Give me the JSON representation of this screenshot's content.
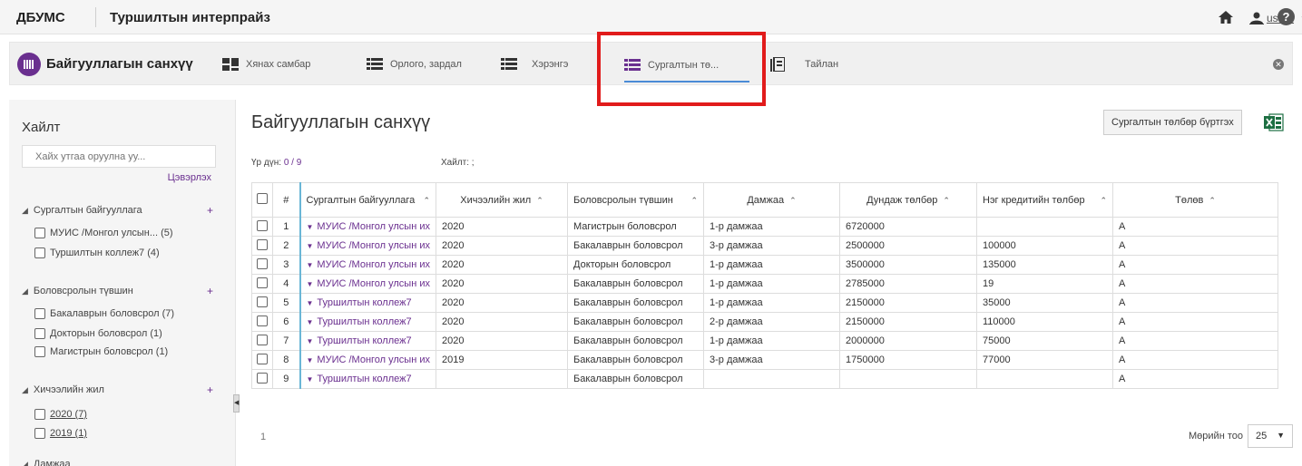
{
  "topbar": {
    "brand": "ДБУМС",
    "subtitle": "Туршилтын интерпрайз",
    "user": "user1"
  },
  "nav": {
    "title": "Байгууллагын санхүү",
    "items": [
      {
        "label": "Хянах самбар",
        "icon": "dashboard-icon"
      },
      {
        "label": "Орлого, зардал",
        "icon": "list-icon"
      },
      {
        "label": "Хэрэнгэ",
        "icon": "list-icon"
      },
      {
        "label": "Сургалтын тө...",
        "icon": "list-icon",
        "active": true
      },
      {
        "label": "Тайлан",
        "icon": "report-icon"
      }
    ],
    "highlight_color": "#e11b1b"
  },
  "sidebar": {
    "heading": "Хайлт",
    "search_placeholder": "Хайх утгаа оруулна уу...",
    "clear_label": "Цэвэрлэх",
    "facets": [
      {
        "title": "Сургалтын байгууллага",
        "options": [
          "МУИС /Монгол улсын... (5)",
          "Туршилтын коллеж7 (4)"
        ]
      },
      {
        "title": "Боловсролын түвшин",
        "options": [
          "Бакалаврын боловсрол (7)",
          "Докторын боловсрол (1)",
          "Магистрын боловсрол (1)"
        ]
      },
      {
        "title": "Хичээлийн жил",
        "options": [
          "2020 (7)",
          "2019 (1)"
        ]
      },
      {
        "title": "Дамжаа",
        "options": []
      }
    ]
  },
  "main": {
    "title": "Байгууллагын санхүү",
    "register_button": "Сургалтын төлбөр бүртгэх",
    "result_label": "Үр дүн:",
    "result_count": "0 / 9",
    "search_label": "Хайлт:",
    "search_value": ";",
    "accent_color": "#6a2f8f"
  },
  "table": {
    "headers": [
      "#",
      "Сургалтын байгууллага",
      "Хичээлийн жил",
      "Боловсролын түвшин",
      "Дамжаа",
      "Дундаж төлбөр",
      "Нэг кредитийн төлбөр",
      "Төлөв"
    ],
    "rows": [
      [
        "1",
        "МУИС /Монгол улсын их",
        "2020",
        "Магистрын боловсрол",
        "1-р дамжаа",
        "6720000",
        "",
        "A"
      ],
      [
        "2",
        "МУИС /Монгол улсын их",
        "2020",
        "Бакалаврын боловсрол",
        "3-р дамжаа",
        "2500000",
        "100000",
        "A"
      ],
      [
        "3",
        "МУИС /Монгол улсын их",
        "2020",
        "Докторын боловсрол",
        "1-р дамжаа",
        "3500000",
        "135000",
        "A"
      ],
      [
        "4",
        "МУИС /Монгол улсын их",
        "2020",
        "Бакалаврын боловсрол",
        "1-р дамжаа",
        "2785000",
        "19",
        "A"
      ],
      [
        "5",
        "Туршилтын коллеж7",
        "2020",
        "Бакалаврын боловсрол",
        "1-р дамжаа",
        "2150000",
        "35000",
        "A"
      ],
      [
        "6",
        "Туршилтын коллеж7",
        "2020",
        "Бакалаврын боловсрол",
        "2-р дамжаа",
        "2150000",
        "110000",
        "A"
      ],
      [
        "7",
        "Туршилтын коллеж7",
        "2020",
        "Бакалаврын боловсрол",
        "1-р дамжаа",
        "2000000",
        "75000",
        "A"
      ],
      [
        "8",
        "МУИС /Монгол улсын их",
        "2019",
        "Бакалаврын боловсрол",
        "3-р дамжаа",
        "1750000",
        "77000",
        "A"
      ],
      [
        "9",
        "Туршилтын коллеж7",
        "",
        "Бакалаврын боловсрол",
        "",
        "",
        "",
        "A"
      ]
    ]
  },
  "pager": {
    "page": "1",
    "rows_label": "Мөрийн тоо",
    "rows_value": "25"
  }
}
